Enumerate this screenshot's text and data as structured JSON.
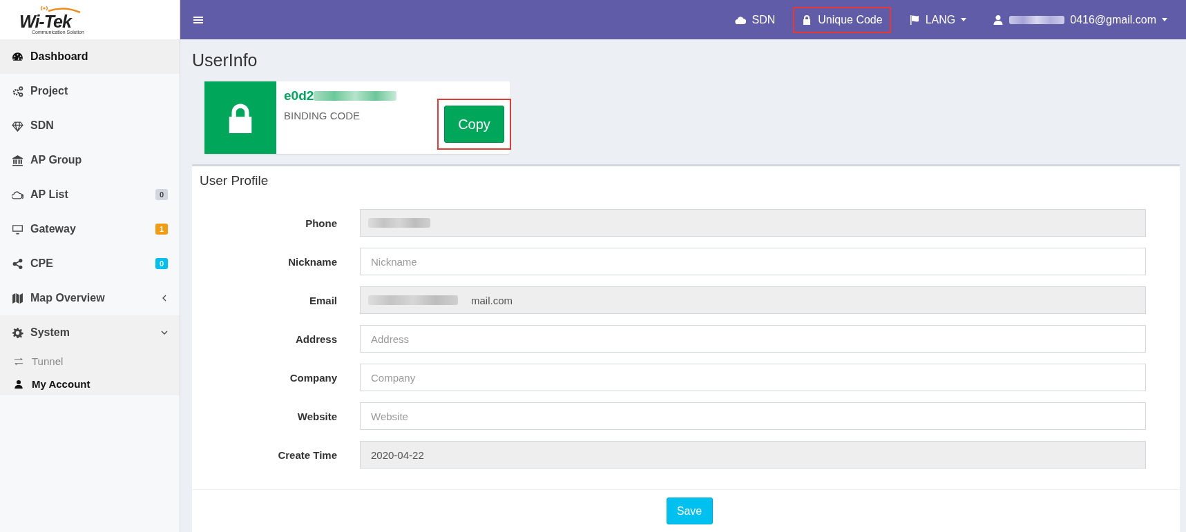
{
  "logo": {
    "name": "Wi-Tek",
    "tagline": "Communication Solution"
  },
  "topbar": {
    "items": [
      {
        "label": "SDN",
        "highlighted": false
      },
      {
        "label": "Unique Code",
        "highlighted": true
      },
      {
        "label": "LANG",
        "highlighted": false,
        "dropdown": true
      },
      {
        "label": "0416@gmail.com",
        "highlighted": false,
        "dropdown": true,
        "redacted": true
      }
    ]
  },
  "sidebar": {
    "items": [
      {
        "label": "Dashboard",
        "selected": true
      },
      {
        "label": "Project",
        "selected": false
      },
      {
        "label": "SDN",
        "selected": false
      },
      {
        "label": "AP Group",
        "selected": false
      },
      {
        "label": "AP List",
        "selected": false,
        "badge": "0",
        "color": "#d2d6de"
      },
      {
        "label": "Gateway",
        "selected": false,
        "badge": "1",
        "color": "#f39c12"
      },
      {
        "label": "CPE",
        "selected": false,
        "badge": "0",
        "color": "#00c0ef"
      },
      {
        "label": "Map Overview",
        "selected": false,
        "expanded": false
      },
      {
        "label": "System",
        "selected": false,
        "expanded": true,
        "children": [
          {
            "label": "Tunnel",
            "selected": false
          },
          {
            "label": "My Account",
            "selected": true
          }
        ]
      }
    ]
  },
  "page_title": "UserInfo",
  "binding": {
    "code": "e0d2",
    "code_redacted": true,
    "label": "BINDING CODE",
    "button": "Copy",
    "button_highlighted": true
  },
  "profile": {
    "title": "User Profile",
    "fields": [
      {
        "label": "Phone",
        "readonly": true,
        "redacted": true
      },
      {
        "label": "Nickname",
        "readonly": false,
        "placeholder": "Nickname"
      },
      {
        "label": "Email",
        "readonly": true,
        "redacted": true,
        "value": "mail.com"
      },
      {
        "label": "Address",
        "readonly": false,
        "placeholder": "Address"
      },
      {
        "label": "Company",
        "readonly": false,
        "placeholder": "Company"
      },
      {
        "label": "Website",
        "readonly": false,
        "placeholder": "Website"
      },
      {
        "label": "Create Time",
        "readonly": true,
        "value": "2020-04-22"
      }
    ],
    "save": "Save"
  }
}
